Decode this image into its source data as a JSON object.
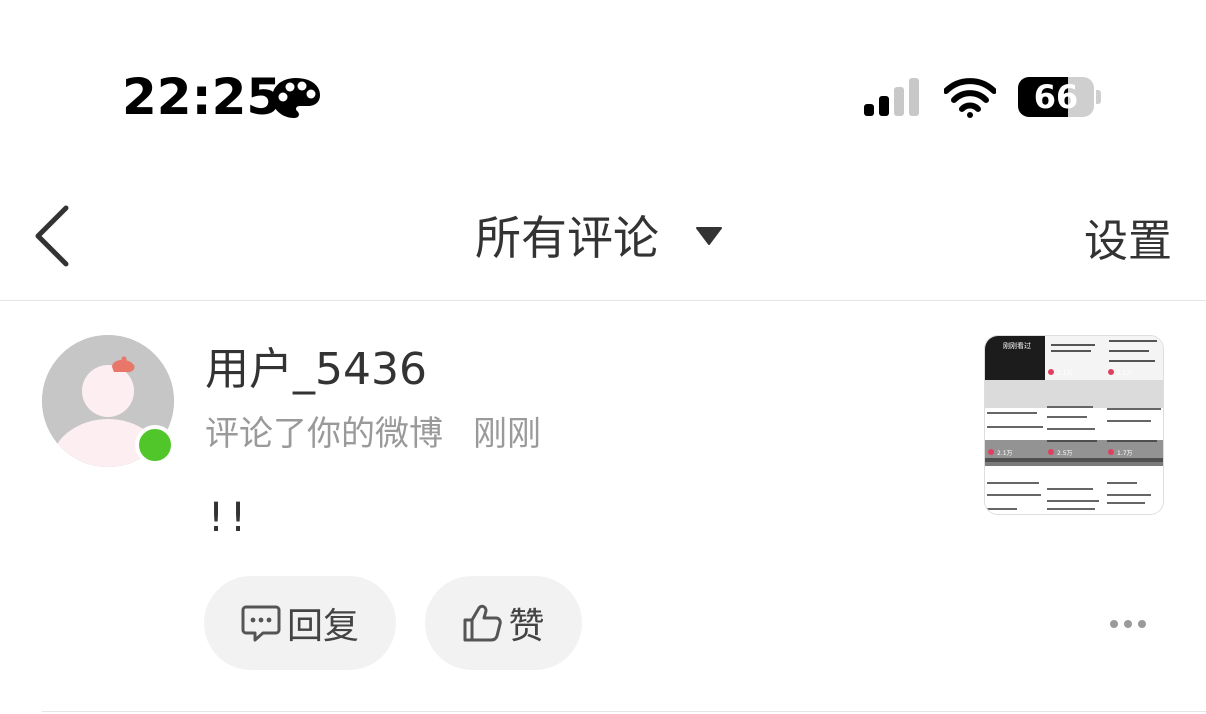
{
  "status_bar": {
    "time": "22:25",
    "battery_percent": "66",
    "battery_level": 0.66,
    "icons": [
      "focus-icon",
      "signal-icon",
      "wifi-icon",
      "battery-icon"
    ]
  },
  "nav": {
    "title": "所有评论",
    "settings_label": "设置",
    "icons": [
      "back-icon",
      "caret-down-icon"
    ]
  },
  "comment": {
    "username": "用户_5436",
    "action_text": "评论了你的微博",
    "time_text": "刚刚",
    "content": "!!",
    "online": true,
    "reply_label": "回复",
    "like_label": "赞",
    "icons": [
      "avatar",
      "reply-icon",
      "like-icon",
      "more-icon"
    ]
  },
  "thumbnail": {
    "header_label": "刚刚看过",
    "counts": [
      "2.1万",
      "2.1万",
      "2.5万",
      "1.7万",
      "2.1万"
    ]
  },
  "colors": {
    "online_dot": "#50c62b",
    "text_primary": "#333333",
    "text_secondary": "#9a9a9a",
    "button_bg": "#f2f2f2"
  }
}
